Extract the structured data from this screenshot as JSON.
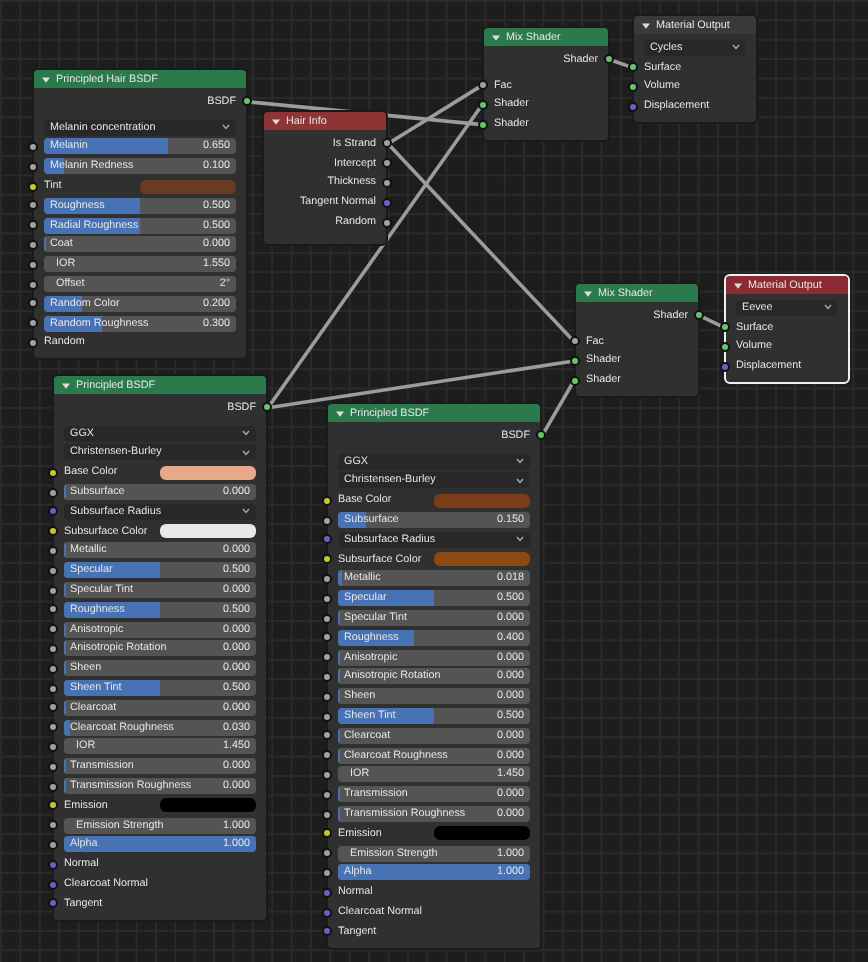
{
  "nodes": [
    {
      "title": "Principled Hair BSDF",
      "kind": "shader",
      "selected": false,
      "outputs": [
        {
          "label": "BSDF",
          "socket": {
            "color": "#63c763"
          }
        }
      ],
      "rows": [
        {
          "kind": "dropdown",
          "value": "Melanin concentration"
        },
        {
          "kind": "slider",
          "label": "Melanin",
          "value": "0.650",
          "level": 0.65,
          "socket": {
            "color": "#a1a1a1"
          }
        },
        {
          "kind": "slider",
          "label": "Melanin Redness",
          "value": "0.100",
          "level": 0.1,
          "socket": {
            "color": "#a1a1a1"
          }
        },
        {
          "kind": "color",
          "label": "Tint",
          "color": "#6b3a22",
          "socket": {
            "color": "#c7c729"
          }
        },
        {
          "kind": "slider",
          "label": "Roughness",
          "value": "0.500",
          "level": 0.5,
          "socket": {
            "color": "#a1a1a1"
          }
        },
        {
          "kind": "slider",
          "label": "Radial Roughness",
          "value": "0.500",
          "level": 0.5,
          "socket": {
            "color": "#a1a1a1"
          }
        },
        {
          "kind": "slider",
          "label": "Coat",
          "value": "0.000",
          "level": 0,
          "socket": {
            "color": "#a1a1a1"
          }
        },
        {
          "kind": "field",
          "label": "IOR",
          "value": "1.550",
          "socket": {
            "color": "#a1a1a1"
          }
        },
        {
          "kind": "field",
          "label": "Offset",
          "value": "2°",
          "socket": {
            "color": "#a1a1a1"
          }
        },
        {
          "kind": "slider",
          "label": "Random Color",
          "value": "0.200",
          "level": 0.2,
          "socket": {
            "color": "#a1a1a1"
          }
        },
        {
          "kind": "slider",
          "label": "Random Roughness",
          "value": "0.300",
          "level": 0.3,
          "socket": {
            "color": "#a1a1a1"
          }
        },
        {
          "kind": "input",
          "label": "Random",
          "socket": {
            "color": "#a1a1a1"
          }
        }
      ]
    },
    {
      "title": "Hair Info",
      "kind": "input",
      "selected": false,
      "outputs": [
        {
          "label": "Is Strand",
          "socket": {
            "color": "#a1a1a1"
          }
        },
        {
          "label": "Intercept",
          "socket": {
            "color": "#a1a1a1"
          }
        },
        {
          "label": "Thickness",
          "socket": {
            "color": "#a1a1a1"
          }
        },
        {
          "label": "Tangent Normal",
          "socket": {
            "color": "#6363c7"
          }
        },
        {
          "label": "Random",
          "socket": {
            "color": "#a1a1a1"
          }
        }
      ]
    },
    {
      "title": "Mix Shader",
      "kind": "shader",
      "selected": false,
      "outputs": [
        {
          "label": "Shader",
          "socket": {
            "color": "#63c763"
          }
        }
      ],
      "rows": [
        {
          "kind": "input",
          "label": "Fac",
          "socket": {
            "color": "#a1a1a1"
          }
        },
        {
          "kind": "input",
          "label": "Shader",
          "socket": {
            "color": "#63c763"
          }
        },
        {
          "kind": "input",
          "label": "Shader",
          "socket": {
            "color": "#63c763"
          }
        }
      ]
    },
    {
      "title": "Material Output",
      "kind": "output",
      "active": false,
      "selected": false,
      "rows": [
        {
          "kind": "dropdown",
          "value": "Cycles"
        },
        {
          "kind": "input",
          "label": "Surface",
          "socket": {
            "color": "#63c763"
          }
        },
        {
          "kind": "input",
          "label": "Volume",
          "socket": {
            "color": "#63c763"
          }
        },
        {
          "kind": "input",
          "label": "Displacement",
          "socket": {
            "color": "#6363c7"
          }
        }
      ]
    },
    {
      "title": "Mix Shader",
      "kind": "shader",
      "selected": false,
      "outputs": [
        {
          "label": "Shader",
          "socket": {
            "color": "#63c763"
          }
        }
      ],
      "rows": [
        {
          "kind": "input",
          "label": "Fac",
          "socket": {
            "color": "#a1a1a1"
          }
        },
        {
          "kind": "input",
          "label": "Shader",
          "socket": {
            "color": "#63c763"
          }
        },
        {
          "kind": "input",
          "label": "Shader",
          "socket": {
            "color": "#63c763"
          }
        }
      ]
    },
    {
      "title": "Material Output",
      "kind": "output",
      "active": true,
      "selected": true,
      "rows": [
        {
          "kind": "dropdown",
          "value": "Eevee"
        },
        {
          "kind": "input",
          "label": "Surface",
          "socket": {
            "color": "#63c763"
          }
        },
        {
          "kind": "input",
          "label": "Volume",
          "socket": {
            "color": "#63c763"
          }
        },
        {
          "kind": "input",
          "label": "Displacement",
          "socket": {
            "color": "#6363c7"
          }
        }
      ]
    },
    {
      "title": "Principled BSDF",
      "kind": "shader",
      "selected": false,
      "outputs": [
        {
          "label": "BSDF",
          "socket": {
            "color": "#63c763"
          }
        }
      ],
      "rows": [
        {
          "kind": "dropdown",
          "value": "GGX"
        },
        {
          "kind": "dropdown",
          "value": "Christensen-Burley"
        },
        {
          "kind": "color",
          "label": "Base Color",
          "color": "#e8a98a",
          "socket": {
            "color": "#c7c729"
          }
        },
        {
          "kind": "slider",
          "label": "Subsurface",
          "value": "0.000",
          "level": 0,
          "socket": {
            "color": "#a1a1a1"
          }
        },
        {
          "kind": "dropdown",
          "value": "Subsurface Radius",
          "socket": {
            "color": "#6363c7"
          }
        },
        {
          "kind": "color",
          "label": "Subsurface Color",
          "color": "#e9e9e9",
          "socket": {
            "color": "#c7c729"
          }
        },
        {
          "kind": "slider",
          "label": "Metallic",
          "value": "0.000",
          "level": 0,
          "socket": {
            "color": "#a1a1a1"
          }
        },
        {
          "kind": "slider",
          "label": "Specular",
          "value": "0.500",
          "level": 0.5,
          "socket": {
            "color": "#a1a1a1"
          }
        },
        {
          "kind": "slider",
          "label": "Specular Tint",
          "value": "0.000",
          "level": 0,
          "socket": {
            "color": "#a1a1a1"
          }
        },
        {
          "kind": "slider",
          "label": "Roughness",
          "value": "0.500",
          "level": 0.5,
          "socket": {
            "color": "#a1a1a1"
          }
        },
        {
          "kind": "slider",
          "label": "Anisotropic",
          "value": "0.000",
          "level": 0,
          "socket": {
            "color": "#a1a1a1"
          }
        },
        {
          "kind": "slider",
          "label": "Anisotropic Rotation",
          "value": "0.000",
          "level": 0,
          "socket": {
            "color": "#a1a1a1"
          }
        },
        {
          "kind": "slider",
          "label": "Sheen",
          "value": "0.000",
          "level": 0,
          "socket": {
            "color": "#a1a1a1"
          }
        },
        {
          "kind": "slider",
          "label": "Sheen Tint",
          "value": "0.500",
          "level": 0.5,
          "socket": {
            "color": "#a1a1a1"
          }
        },
        {
          "kind": "slider",
          "label": "Clearcoat",
          "value": "0.000",
          "level": 0,
          "socket": {
            "color": "#a1a1a1"
          }
        },
        {
          "kind": "slider",
          "label": "Clearcoat Roughness",
          "value": "0.030",
          "level": 0.03,
          "socket": {
            "color": "#a1a1a1"
          }
        },
        {
          "kind": "field",
          "label": "IOR",
          "value": "1.450",
          "socket": {
            "color": "#a1a1a1"
          }
        },
        {
          "kind": "slider",
          "label": "Transmission",
          "value": "0.000",
          "level": 0,
          "socket": {
            "color": "#a1a1a1"
          }
        },
        {
          "kind": "slider",
          "label": "Transmission Roughness",
          "value": "0.000",
          "level": 0,
          "socket": {
            "color": "#a1a1a1"
          }
        },
        {
          "kind": "color",
          "label": "Emission",
          "color": "#000000",
          "socket": {
            "color": "#c7c729"
          }
        },
        {
          "kind": "field",
          "label": "Emission Strength",
          "value": "1.000",
          "socket": {
            "color": "#a1a1a1"
          }
        },
        {
          "kind": "slider",
          "label": "Alpha",
          "value": "1.000",
          "level": 1,
          "socket": {
            "color": "#a1a1a1"
          }
        },
        {
          "kind": "input",
          "label": "Normal",
          "socket": {
            "color": "#6363c7"
          }
        },
        {
          "kind": "input",
          "label": "Clearcoat Normal",
          "socket": {
            "color": "#6363c7"
          }
        },
        {
          "kind": "input",
          "label": "Tangent",
          "socket": {
            "color": "#6363c7"
          }
        }
      ]
    },
    {
      "title": "Principled BSDF",
      "kind": "shader",
      "selected": false,
      "outputs": [
        {
          "label": "BSDF",
          "socket": {
            "color": "#63c763"
          }
        }
      ],
      "rows": [
        {
          "kind": "dropdown",
          "value": "GGX"
        },
        {
          "kind": "dropdown",
          "value": "Christensen-Burley"
        },
        {
          "kind": "color",
          "label": "Base Color",
          "color": "#7a3d18",
          "socket": {
            "color": "#c7c729"
          }
        },
        {
          "kind": "slider",
          "label": "Subsurface",
          "value": "0.150",
          "level": 0.15,
          "socket": {
            "color": "#a1a1a1"
          }
        },
        {
          "kind": "dropdown",
          "value": "Subsurface Radius",
          "socket": {
            "color": "#6363c7"
          }
        },
        {
          "kind": "color",
          "label": "Subsurface Color",
          "color": "#8c4a12",
          "socket": {
            "color": "#c7c729"
          }
        },
        {
          "kind": "slider",
          "label": "Metallic",
          "value": "0.018",
          "level": 0.018,
          "socket": {
            "color": "#a1a1a1"
          }
        },
        {
          "kind": "slider",
          "label": "Specular",
          "value": "0.500",
          "level": 0.5,
          "socket": {
            "color": "#a1a1a1"
          }
        },
        {
          "kind": "slider",
          "label": "Specular Tint",
          "value": "0.000",
          "level": 0,
          "socket": {
            "color": "#a1a1a1"
          }
        },
        {
          "kind": "slider",
          "label": "Roughness",
          "value": "0.400",
          "level": 0.4,
          "socket": {
            "color": "#a1a1a1"
          }
        },
        {
          "kind": "slider",
          "label": "Anisotropic",
          "value": "0.000",
          "level": 0,
          "socket": {
            "color": "#a1a1a1"
          }
        },
        {
          "kind": "slider",
          "label": "Anisotropic Rotation",
          "value": "0.000",
          "level": 0,
          "socket": {
            "color": "#a1a1a1"
          }
        },
        {
          "kind": "slider",
          "label": "Sheen",
          "value": "0.000",
          "level": 0,
          "socket": {
            "color": "#a1a1a1"
          }
        },
        {
          "kind": "slider",
          "label": "Sheen Tint",
          "value": "0.500",
          "level": 0.5,
          "socket": {
            "color": "#a1a1a1"
          }
        },
        {
          "kind": "slider",
          "label": "Clearcoat",
          "value": "0.000",
          "level": 0,
          "socket": {
            "color": "#a1a1a1"
          }
        },
        {
          "kind": "slider",
          "label": "Clearcoat Roughness",
          "value": "0.000",
          "level": 0,
          "socket": {
            "color": "#a1a1a1"
          }
        },
        {
          "kind": "field",
          "label": "IOR",
          "value": "1.450",
          "socket": {
            "color": "#a1a1a1"
          }
        },
        {
          "kind": "slider",
          "label": "Transmission",
          "value": "0.000",
          "level": 0,
          "socket": {
            "color": "#a1a1a1"
          }
        },
        {
          "kind": "slider",
          "label": "Transmission Roughness",
          "value": "0.000",
          "level": 0,
          "socket": {
            "color": "#a1a1a1"
          }
        },
        {
          "kind": "color",
          "label": "Emission",
          "color": "#000000",
          "socket": {
            "color": "#c7c729"
          }
        },
        {
          "kind": "field",
          "label": "Emission Strength",
          "value": "1.000",
          "socket": {
            "color": "#a1a1a1"
          }
        },
        {
          "kind": "slider",
          "label": "Alpha",
          "value": "1.000",
          "level": 1,
          "socket": {
            "color": "#a1a1a1"
          }
        },
        {
          "kind": "input",
          "label": "Normal",
          "socket": {
            "color": "#6363c7"
          }
        },
        {
          "kind": "input",
          "label": "Clearcoat Normal",
          "socket": {
            "color": "#6363c7"
          }
        },
        {
          "kind": "input",
          "label": "Tangent",
          "socket": {
            "color": "#6363c7"
          }
        }
      ]
    }
  ]
}
